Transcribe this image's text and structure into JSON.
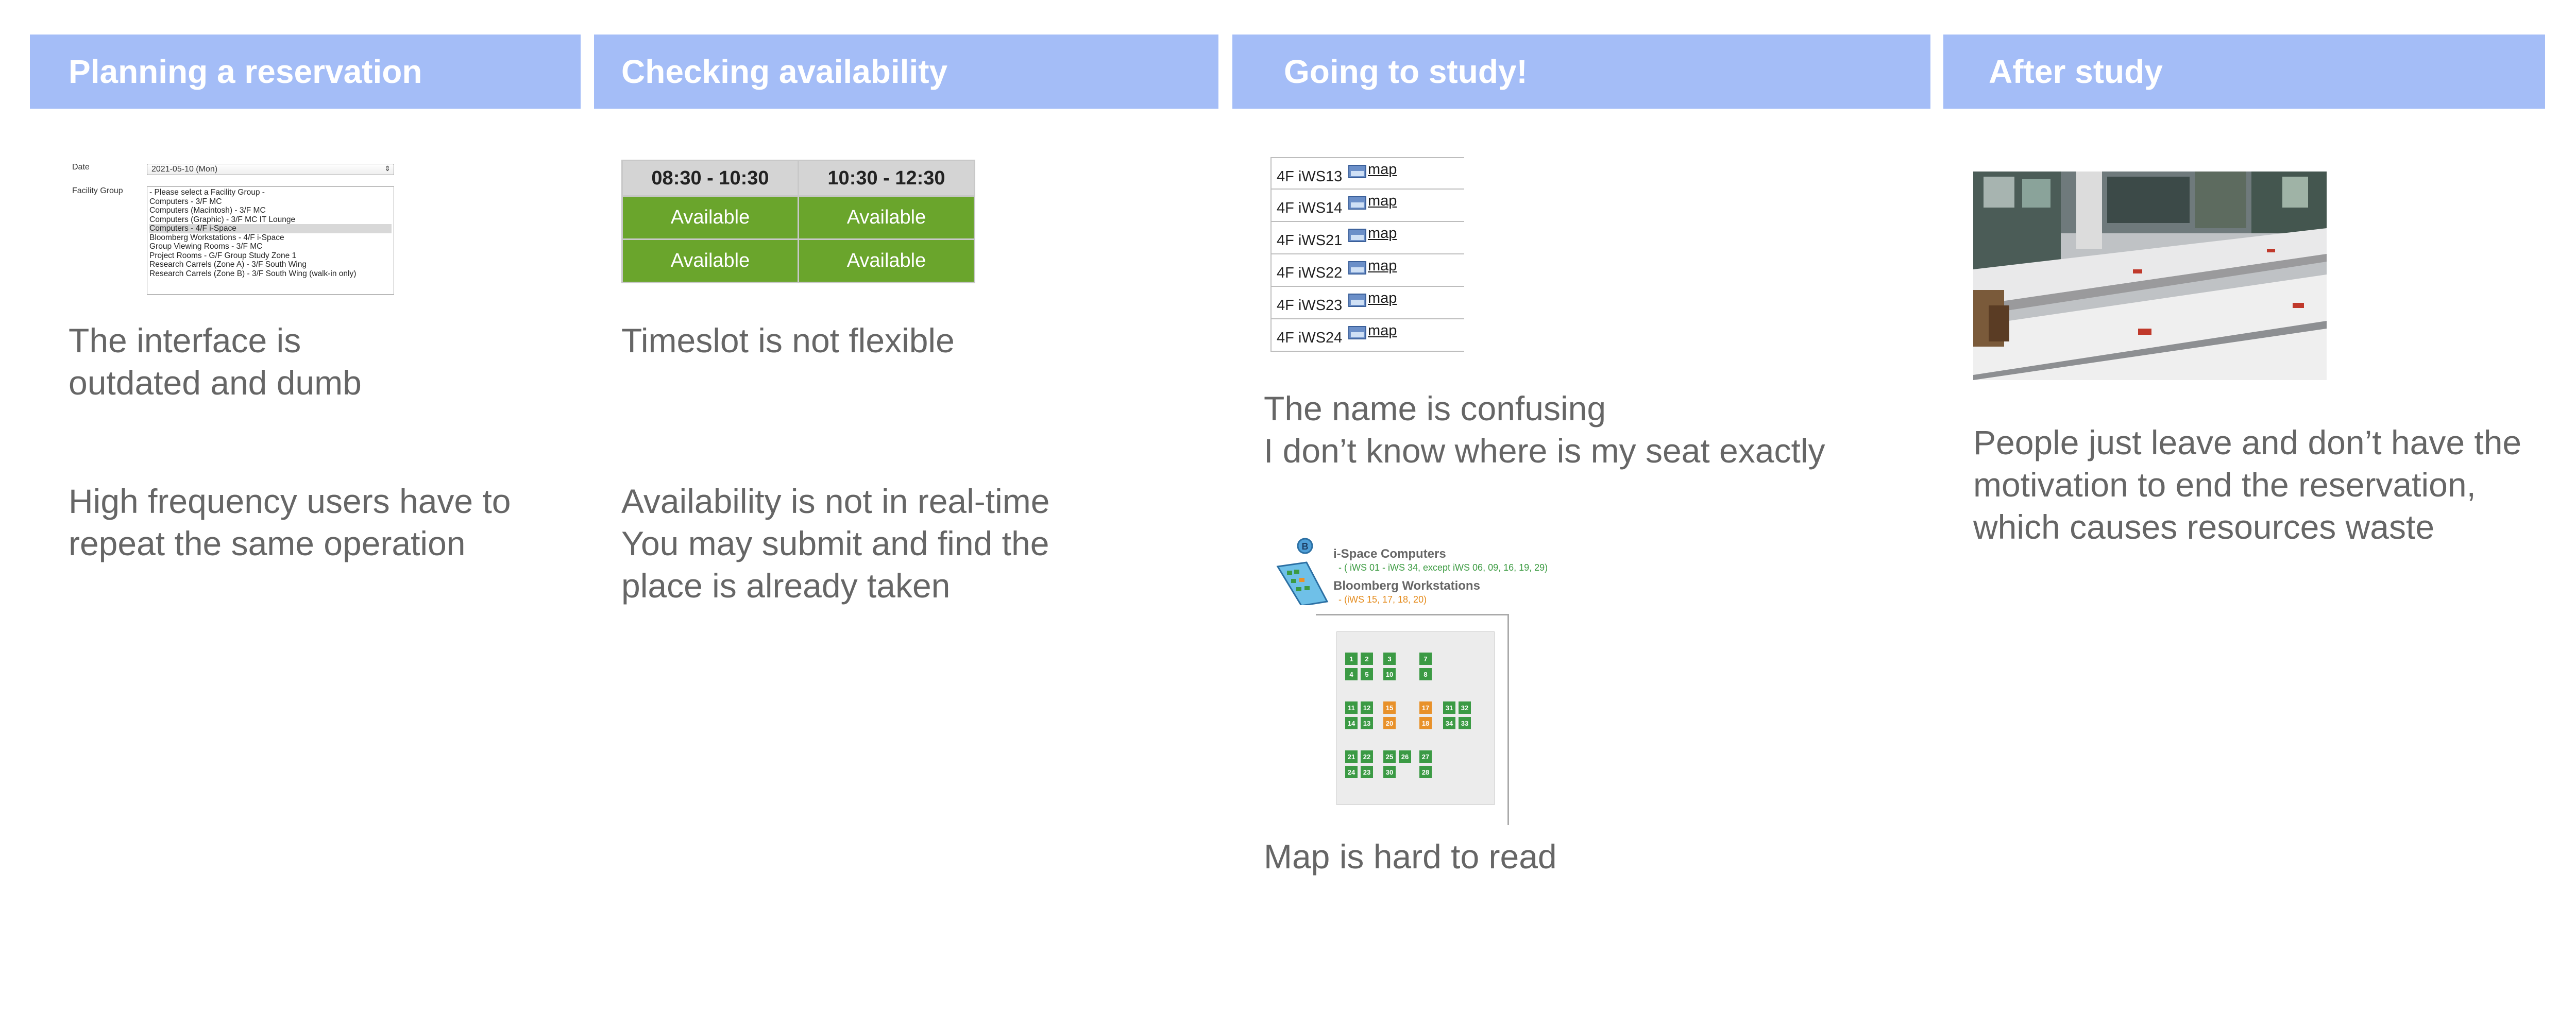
{
  "columns": [
    {
      "title": "Planning a reservation"
    },
    {
      "title": "Checking availability"
    },
    {
      "title": "Going to study!"
    },
    {
      "title": "After study"
    }
  ],
  "planning": {
    "form": {
      "date_label": "Date",
      "date_value": "2021-05-10     (Mon)",
      "group_label": "Facility Group",
      "options": [
        "- Please select a Facility Group -",
        "Computers - 3/F MC",
        "Computers (Macintosh) - 3/F MC",
        "Computers (Graphic) - 3/F MC IT Lounge",
        "Computers - 4/F i-Space",
        "Bloomberg Workstations - 4/F i-Space",
        "Group Viewing Rooms - 3/F MC",
        "Project Rooms - G/F Group Study Zone 1",
        "Research Carrels (Zone A) - 3/F South Wing",
        "Research Carrels (Zone B) - 3/F South Wing (walk-in only)"
      ],
      "selected_index": 4
    },
    "note1": "The interface is\noutdated and dumb",
    "note2": "High frequency users have to\nrepeat the same operation"
  },
  "availability": {
    "slots": [
      "08:30 - 10:30",
      "10:30 - 12:30"
    ],
    "rows": [
      [
        "Available",
        "Available"
      ],
      [
        "Available",
        "Available"
      ]
    ],
    "note1": "Timeslot is not flexible",
    "note2": "Availability is not in real-time\nYou may submit and find the\nplace is already taken"
  },
  "study": {
    "seats": [
      {
        "code": "4F iWS13",
        "link": "map"
      },
      {
        "code": "4F iWS14",
        "link": "map"
      },
      {
        "code": "4F iWS21",
        "link": "map"
      },
      {
        "code": "4F iWS22",
        "link": "map"
      },
      {
        "code": "4F iWS23",
        "link": "map"
      },
      {
        "code": "4F iWS24",
        "link": "map"
      }
    ],
    "note1": "The name is confusing\nI don’t know where is my seat exactly",
    "map": {
      "legend_1": "i-Space Computers",
      "legend_1_sub": "-  ( iWS 01 - iWS 34, except iWS 06, 09, 16, 19, 29)",
      "legend_2": "Bloomberg Workstations",
      "legend_2_sub": "-  (iWS 15, 17, 18, 20)",
      "colors": {
        "computer": "#3b9a44",
        "bloomberg": "#e8912a"
      },
      "seats": [
        "1",
        "2",
        "3",
        "7",
        "4",
        "5",
        "10",
        "8",
        "11",
        "12",
        "15",
        "17",
        "31",
        "32",
        "14",
        "13",
        "20",
        "18",
        "34",
        "33",
        "21",
        "22",
        "25",
        "26",
        "27",
        "24",
        "23",
        "30",
        "28"
      ]
    },
    "note2": "Map is hard to read"
  },
  "after": {
    "photo_alt": "library-desks-photo",
    "note1": "People just leave and don’t have the\nmotivation to end the reservation,\nwhich causes resources waste"
  }
}
